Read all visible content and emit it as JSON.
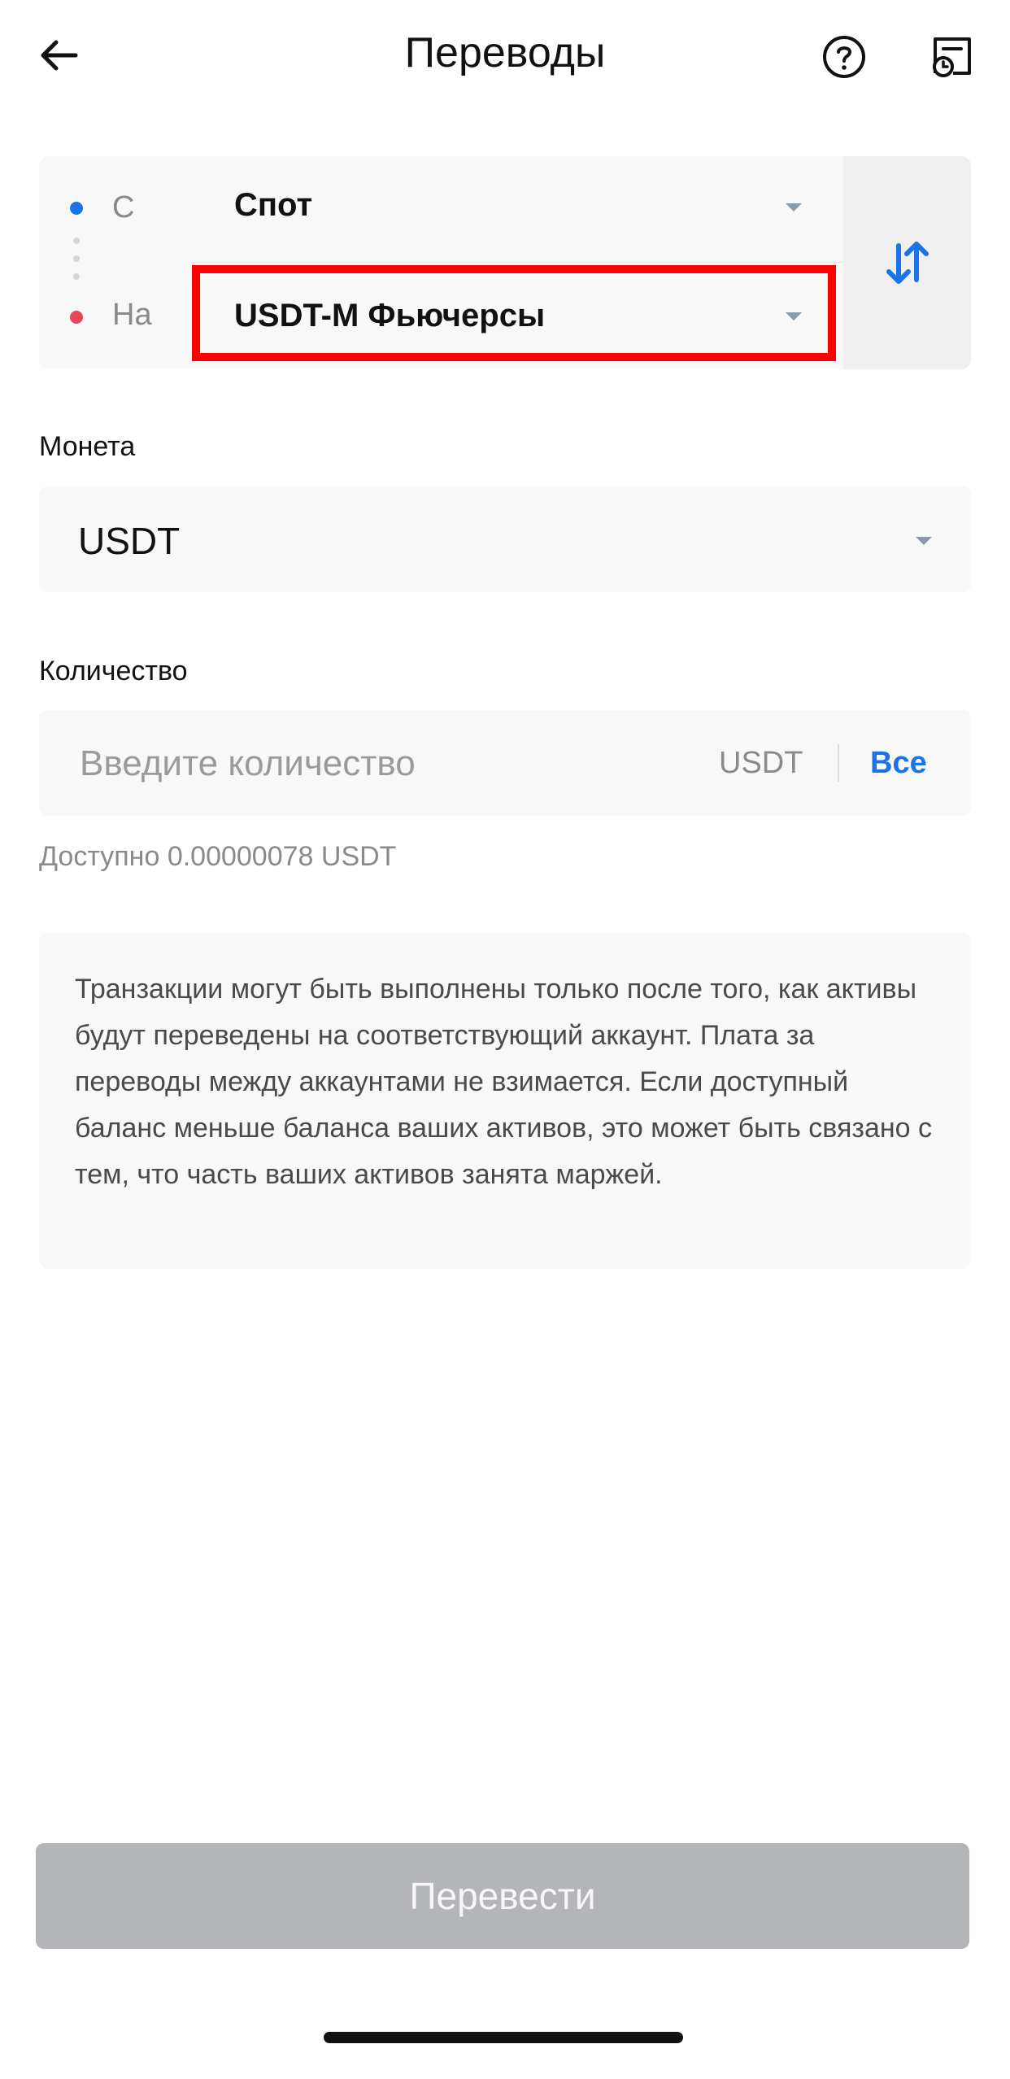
{
  "header": {
    "title": "Переводы"
  },
  "transfer": {
    "from_label": "С",
    "from_value": "Спот",
    "to_label": "На",
    "to_value": "USDT-M Фьючерсы"
  },
  "coin": {
    "label": "Монета",
    "value": "USDT"
  },
  "quantity": {
    "label": "Количество",
    "placeholder": "Введите количество",
    "unit": "USDT",
    "all_label": "Все",
    "available": "Доступно 0.00000078 USDT"
  },
  "info": {
    "text": "Транзакции могут быть выполнены только после того, как активы будут переведены на соответствующий аккаунт. Плата за переводы между аккаунтами не взимается. Если доступный баланс меньше баланса ваших активов, это может быть связано с тем, что часть ваших активов занята маржей."
  },
  "actions": {
    "submit_label": "Перевести"
  },
  "colors": {
    "accent": "#1a73e8",
    "to_dot": "#e5485d",
    "highlight": "#ff0000",
    "disabled_button": "#b3b5b8"
  }
}
